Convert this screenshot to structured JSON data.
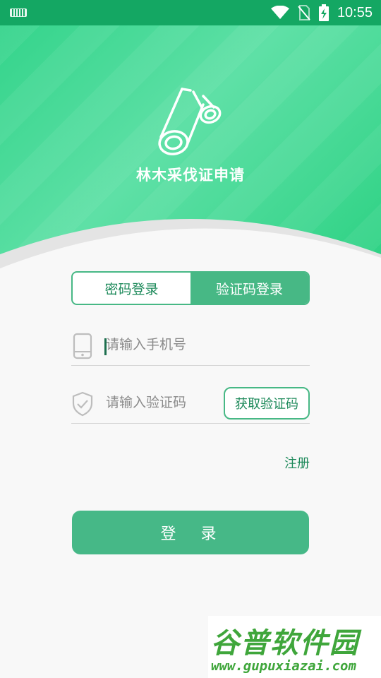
{
  "status_bar": {
    "time": "10:55"
  },
  "app": {
    "title": "林木采伐证申请"
  },
  "tabs": [
    {
      "label": "密码登录",
      "active": false
    },
    {
      "label": "验证码登录",
      "active": true
    }
  ],
  "phone_field": {
    "value": "",
    "placeholder": "请输入手机号",
    "icon": "phone-icon"
  },
  "code_field": {
    "value": "",
    "placeholder": "请输入验证码",
    "icon": "shield-check-icon"
  },
  "get_code_label": "获取验证码",
  "register_label": "注册",
  "login_label": "登 录",
  "watermark": {
    "title": "谷普软件园",
    "url": "www.gupuxiazai.com"
  },
  "colors": {
    "primary": "#47b885",
    "status_bar": "#14a763",
    "hero_start": "#34d48b",
    "hero_end": "#2bd182"
  }
}
